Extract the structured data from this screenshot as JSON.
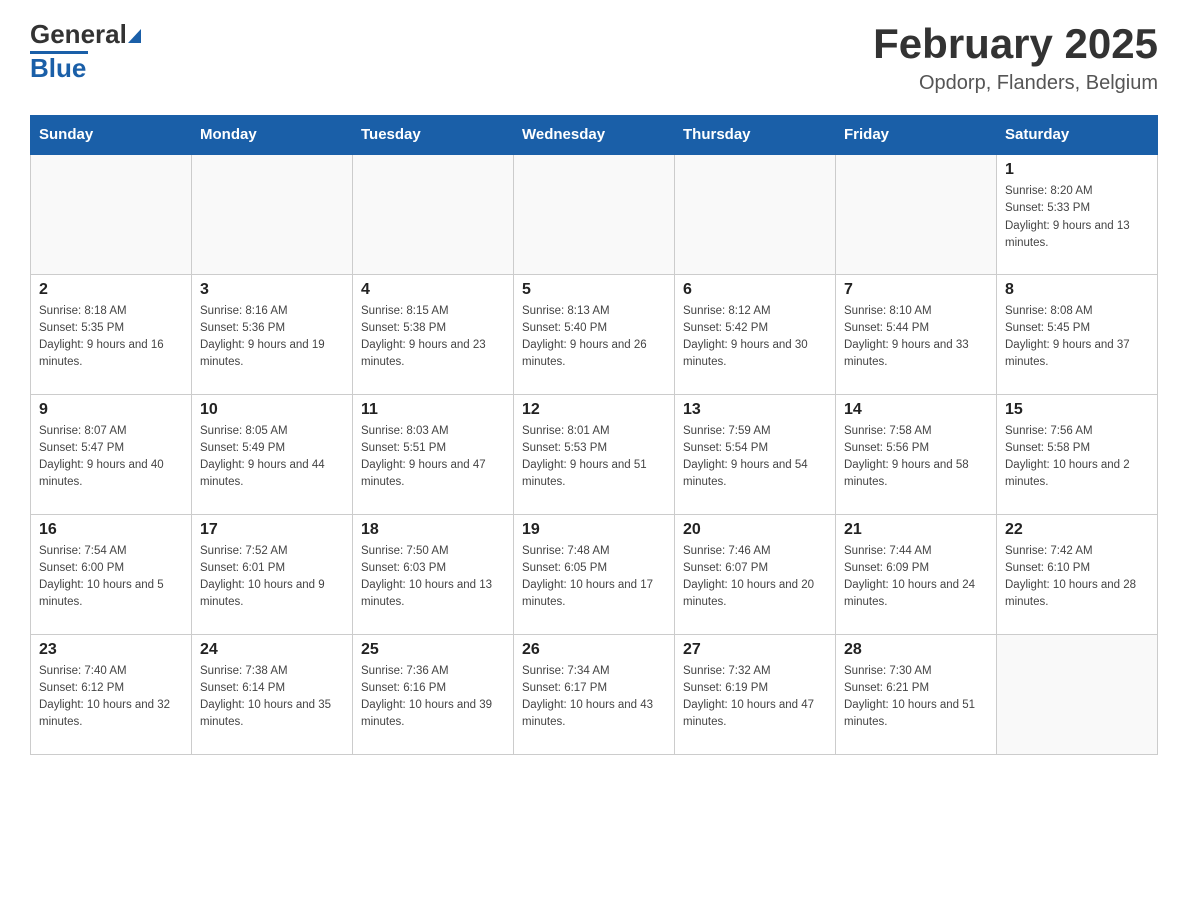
{
  "header": {
    "logo_text_general": "General",
    "logo_text_blue": "Blue",
    "month_title": "February 2025",
    "location": "Opdorp, Flanders, Belgium"
  },
  "days_of_week": [
    "Sunday",
    "Monday",
    "Tuesday",
    "Wednesday",
    "Thursday",
    "Friday",
    "Saturday"
  ],
  "weeks": [
    {
      "days": [
        {
          "number": "",
          "info": ""
        },
        {
          "number": "",
          "info": ""
        },
        {
          "number": "",
          "info": ""
        },
        {
          "number": "",
          "info": ""
        },
        {
          "number": "",
          "info": ""
        },
        {
          "number": "",
          "info": ""
        },
        {
          "number": "1",
          "info": "Sunrise: 8:20 AM\nSunset: 5:33 PM\nDaylight: 9 hours and 13 minutes."
        }
      ]
    },
    {
      "days": [
        {
          "number": "2",
          "info": "Sunrise: 8:18 AM\nSunset: 5:35 PM\nDaylight: 9 hours and 16 minutes."
        },
        {
          "number": "3",
          "info": "Sunrise: 8:16 AM\nSunset: 5:36 PM\nDaylight: 9 hours and 19 minutes."
        },
        {
          "number": "4",
          "info": "Sunrise: 8:15 AM\nSunset: 5:38 PM\nDaylight: 9 hours and 23 minutes."
        },
        {
          "number": "5",
          "info": "Sunrise: 8:13 AM\nSunset: 5:40 PM\nDaylight: 9 hours and 26 minutes."
        },
        {
          "number": "6",
          "info": "Sunrise: 8:12 AM\nSunset: 5:42 PM\nDaylight: 9 hours and 30 minutes."
        },
        {
          "number": "7",
          "info": "Sunrise: 8:10 AM\nSunset: 5:44 PM\nDaylight: 9 hours and 33 minutes."
        },
        {
          "number": "8",
          "info": "Sunrise: 8:08 AM\nSunset: 5:45 PM\nDaylight: 9 hours and 37 minutes."
        }
      ]
    },
    {
      "days": [
        {
          "number": "9",
          "info": "Sunrise: 8:07 AM\nSunset: 5:47 PM\nDaylight: 9 hours and 40 minutes."
        },
        {
          "number": "10",
          "info": "Sunrise: 8:05 AM\nSunset: 5:49 PM\nDaylight: 9 hours and 44 minutes."
        },
        {
          "number": "11",
          "info": "Sunrise: 8:03 AM\nSunset: 5:51 PM\nDaylight: 9 hours and 47 minutes."
        },
        {
          "number": "12",
          "info": "Sunrise: 8:01 AM\nSunset: 5:53 PM\nDaylight: 9 hours and 51 minutes."
        },
        {
          "number": "13",
          "info": "Sunrise: 7:59 AM\nSunset: 5:54 PM\nDaylight: 9 hours and 54 minutes."
        },
        {
          "number": "14",
          "info": "Sunrise: 7:58 AM\nSunset: 5:56 PM\nDaylight: 9 hours and 58 minutes."
        },
        {
          "number": "15",
          "info": "Sunrise: 7:56 AM\nSunset: 5:58 PM\nDaylight: 10 hours and 2 minutes."
        }
      ]
    },
    {
      "days": [
        {
          "number": "16",
          "info": "Sunrise: 7:54 AM\nSunset: 6:00 PM\nDaylight: 10 hours and 5 minutes."
        },
        {
          "number": "17",
          "info": "Sunrise: 7:52 AM\nSunset: 6:01 PM\nDaylight: 10 hours and 9 minutes."
        },
        {
          "number": "18",
          "info": "Sunrise: 7:50 AM\nSunset: 6:03 PM\nDaylight: 10 hours and 13 minutes."
        },
        {
          "number": "19",
          "info": "Sunrise: 7:48 AM\nSunset: 6:05 PM\nDaylight: 10 hours and 17 minutes."
        },
        {
          "number": "20",
          "info": "Sunrise: 7:46 AM\nSunset: 6:07 PM\nDaylight: 10 hours and 20 minutes."
        },
        {
          "number": "21",
          "info": "Sunrise: 7:44 AM\nSunset: 6:09 PM\nDaylight: 10 hours and 24 minutes."
        },
        {
          "number": "22",
          "info": "Sunrise: 7:42 AM\nSunset: 6:10 PM\nDaylight: 10 hours and 28 minutes."
        }
      ]
    },
    {
      "days": [
        {
          "number": "23",
          "info": "Sunrise: 7:40 AM\nSunset: 6:12 PM\nDaylight: 10 hours and 32 minutes."
        },
        {
          "number": "24",
          "info": "Sunrise: 7:38 AM\nSunset: 6:14 PM\nDaylight: 10 hours and 35 minutes."
        },
        {
          "number": "25",
          "info": "Sunrise: 7:36 AM\nSunset: 6:16 PM\nDaylight: 10 hours and 39 minutes."
        },
        {
          "number": "26",
          "info": "Sunrise: 7:34 AM\nSunset: 6:17 PM\nDaylight: 10 hours and 43 minutes."
        },
        {
          "number": "27",
          "info": "Sunrise: 7:32 AM\nSunset: 6:19 PM\nDaylight: 10 hours and 47 minutes."
        },
        {
          "number": "28",
          "info": "Sunrise: 7:30 AM\nSunset: 6:21 PM\nDaylight: 10 hours and 51 minutes."
        },
        {
          "number": "",
          "info": ""
        }
      ]
    }
  ]
}
